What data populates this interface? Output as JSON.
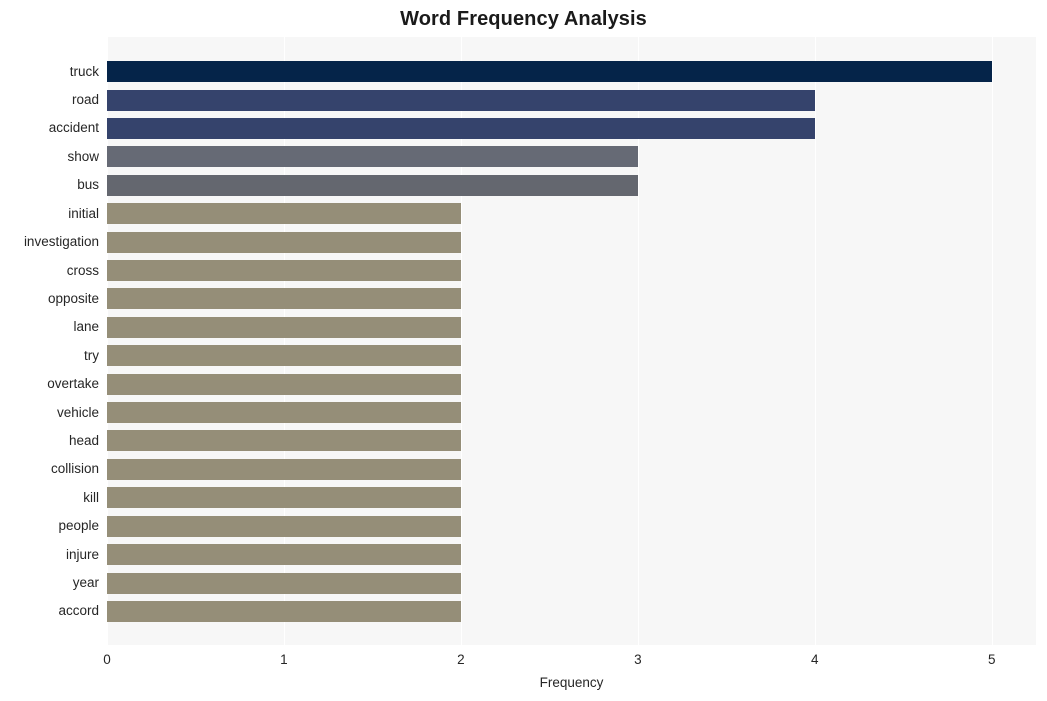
{
  "chart_data": {
    "type": "bar",
    "orientation": "horizontal",
    "title": "Word Frequency Analysis",
    "xlabel": "Frequency",
    "ylabel": "",
    "xlim": [
      0,
      5.25
    ],
    "xticks": [
      0,
      1,
      2,
      3,
      4,
      5
    ],
    "xtick_labels": [
      "0",
      "1",
      "2",
      "3",
      "4",
      "5"
    ],
    "grid": true,
    "grid_axis": "x",
    "legend": false,
    "plot_background": "#f7f7f7",
    "figure_background": "#ffffff",
    "categories": [
      "truck",
      "road",
      "accident",
      "show",
      "bus",
      "initial",
      "investigation",
      "cross",
      "opposite",
      "lane",
      "try",
      "overtake",
      "vehicle",
      "head",
      "collision",
      "kill",
      "people",
      "injure",
      "year",
      "accord"
    ],
    "values": [
      5,
      4,
      4,
      3,
      3,
      2,
      2,
      2,
      2,
      2,
      2,
      2,
      2,
      2,
      2,
      2,
      2,
      2,
      2,
      2
    ],
    "bar_colors": [
      "#052449",
      "#35436c",
      "#35436c",
      "#666a75",
      "#64676f",
      "#958e78",
      "#958e78",
      "#958e78",
      "#958e78",
      "#958e78",
      "#958e78",
      "#958e78",
      "#958e78",
      "#958e78",
      "#958e78",
      "#958e78",
      "#958e78",
      "#958e78",
      "#958e78",
      "#958e78"
    ]
  }
}
